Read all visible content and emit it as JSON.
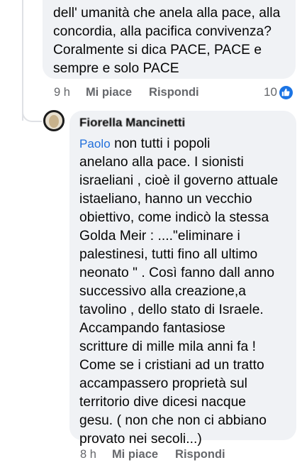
{
  "comment_1": {
    "text": "dell' umanità che anela alla pace, alla\nconcordia, alla pacifica convivenza?\nCoralmente si dica PACE, PACE e\nsempre e solo PACE",
    "time": "9 h",
    "like_label": "Mi piace",
    "reply_label": "Rispondi",
    "reaction_count": "10",
    "reaction_icon": "like-icon",
    "reaction_color": "#1b74e4"
  },
  "comment_2": {
    "author": "Fiorella Mancinetti",
    "mention": "Paolo",
    "text_first": " non tutti i popoli",
    "text": "anelano alla pace. I sionisti\nisraeliani , cioè il governo attuale\nistaeliano, hanno un vecchio\nobiettivo, come indicò la stessa\nGolda Meir : ....\"eliminare i\npalestinesi, tutti fino all ultimo\nneonato \" . Così  fanno dall anno\nsuccessivo alla creazione,a\ntavolino , dello stato di Israele.\nAccampando fantasiose\nscritture di mille mila anni fa !\nCome se i cristiani ad un tratto\naccampassero proprietà sul\nterritorio dive dicesi nacque\ngesu. ( non che non ci abbiano\nprovato nei secoli...)",
    "time": "8 h",
    "like_label": "Mi piace",
    "reply_label": "Rispondi"
  }
}
